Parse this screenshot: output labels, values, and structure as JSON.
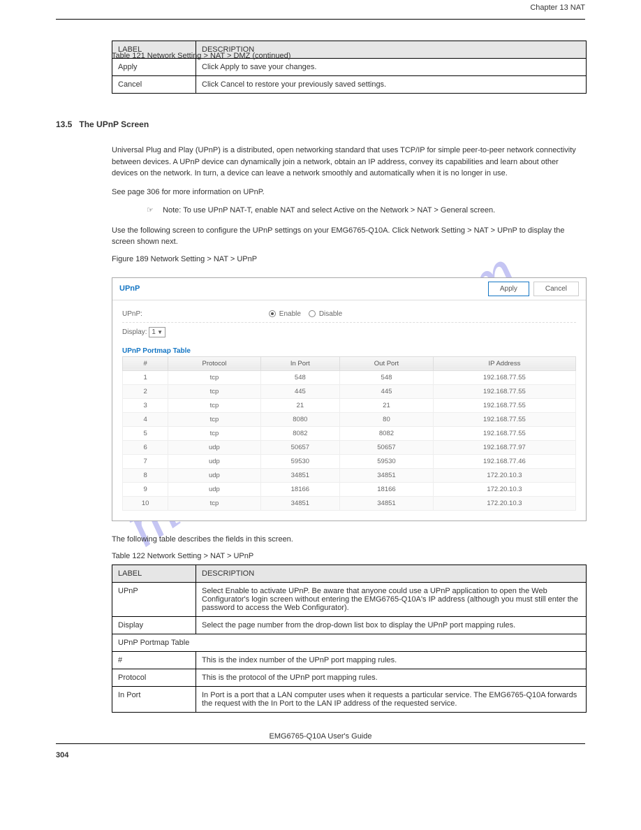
{
  "header_right": "Chapter 13 NAT",
  "table121": {
    "caption": "Table 121   Network Setting > NAT > DMZ (continued)",
    "columns": [
      "LABEL",
      "DESCRIPTION"
    ],
    "rows": [
      {
        "label": "Apply",
        "desc": "Click Apply to save your changes."
      },
      {
        "label": "Cancel",
        "desc": "Click Cancel to restore your previously saved settings."
      }
    ]
  },
  "section": {
    "heading_number": "13.5",
    "heading_title": "The UPnP Screen",
    "paragraph": "Universal Plug and Play (UPnP) is a distributed, open networking standard that uses TCP/IP for simple peer-to-peer network connectivity between devices. A UPnP device can dynamically join a network, obtain an IP address, convey its capabilities and learn about other devices on the network. In turn, a device can leave a network smoothly and automatically when it is no longer in use.",
    "see_also": "See page 306 for more information on UPnP.",
    "note_prefix": "Note:",
    "note_text": "To use UPnP NAT-T, enable NAT and select Active on the Network > NAT > General screen.",
    "use_text": "Use the following screen to configure the UPnP settings on your EMG6765-Q10A. Click Network Setting > NAT > UPnP to display the screen shown next."
  },
  "fig_caption": "Figure 189   Network Setting > NAT > UPnP",
  "screenshot": {
    "title": "UPnP",
    "apply": "Apply",
    "cancel": "Cancel",
    "upnp_label": "UPnP:",
    "enable_label": "Enable",
    "disable_label": "Disable",
    "display_label": "Display:",
    "display_value": "1",
    "table_title": "UPnP Portmap Table",
    "columns": [
      "#",
      "Protocol",
      "In Port",
      "Out Port",
      "IP Address"
    ],
    "rows": [
      {
        "n": "1",
        "proto": "tcp",
        "inport": "548",
        "outport": "548",
        "ip": "192.168.77.55"
      },
      {
        "n": "2",
        "proto": "tcp",
        "inport": "445",
        "outport": "445",
        "ip": "192.168.77.55"
      },
      {
        "n": "3",
        "proto": "tcp",
        "inport": "21",
        "outport": "21",
        "ip": "192.168.77.55"
      },
      {
        "n": "4",
        "proto": "tcp",
        "inport": "8080",
        "outport": "80",
        "ip": "192.168.77.55"
      },
      {
        "n": "5",
        "proto": "tcp",
        "inport": "8082",
        "outport": "8082",
        "ip": "192.168.77.55"
      },
      {
        "n": "6",
        "proto": "udp",
        "inport": "50657",
        "outport": "50657",
        "ip": "192.168.77.97"
      },
      {
        "n": "7",
        "proto": "udp",
        "inport": "59530",
        "outport": "59530",
        "ip": "192.168.77.46"
      },
      {
        "n": "8",
        "proto": "udp",
        "inport": "34851",
        "outport": "34851",
        "ip": "172.20.10.3"
      },
      {
        "n": "9",
        "proto": "udp",
        "inport": "18166",
        "outport": "18166",
        "ip": "172.20.10.3"
      },
      {
        "n": "10",
        "proto": "tcp",
        "inport": "34851",
        "outport": "34851",
        "ip": "172.20.10.3"
      }
    ]
  },
  "pre_table_text": "The following table describes the fields in this screen.",
  "table122": {
    "caption": "Table 122   Network Setting > NAT > UPnP",
    "columns": [
      "LABEL",
      "DESCRIPTION"
    ],
    "rows": [
      {
        "label": "UPnP",
        "desc": "Select Enable to activate UPnP. Be aware that anyone could use a UPnP application to open the Web Configurator's login screen without entering the EMG6765-Q10A's IP address (although you must still enter the password to access the Web Configurator)."
      },
      {
        "label": "Display",
        "desc": "Select the page number from the drop-down list box to display the UPnP port mapping rules."
      },
      {
        "label": "UPnP Portmap Table",
        "desc": ""
      },
      {
        "label": "#",
        "desc": "This is the index number of the UPnP port mapping rules."
      },
      {
        "label": "Protocol",
        "desc": "This is the protocol of the UPnP port mapping rules."
      },
      {
        "label": "In Port",
        "desc": "In Port is a port that a LAN computer uses when it requests a particular service. The EMG6765-Q10A forwards the request with the In Port to the LAN IP address of the requested service."
      }
    ]
  },
  "footer_center": "EMG6765-Q10A User's Guide",
  "footer_page": "304",
  "watermark": "manualshive.com"
}
